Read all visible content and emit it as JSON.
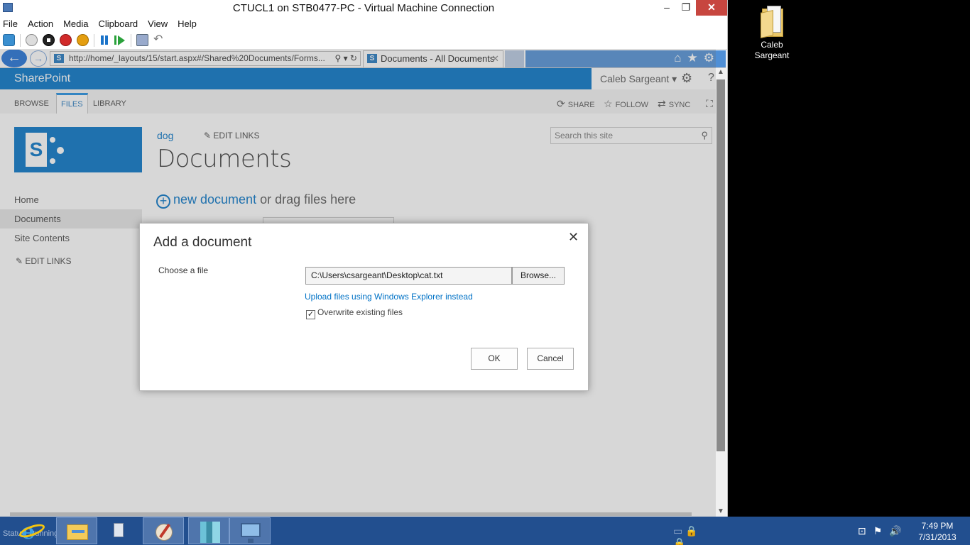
{
  "vm_window": {
    "title": "CTUCL1 on STB0477-PC - Virtual Machine Connection",
    "controls": {
      "minimize": "–",
      "maximize": "❐",
      "close": "✕"
    },
    "menu": [
      "File",
      "Action",
      "Media",
      "Clipboard",
      "View",
      "Help"
    ]
  },
  "browser": {
    "back_glyph": "←",
    "forward_glyph": "→",
    "address": "http://home/_layouts/15/start.aspx#/Shared%20Documents/Forms...",
    "address_tools": "⚲ ▾ ↻",
    "tab_title": "Documents - All Documents",
    "tab_close": "✕",
    "favicon_letter": "S",
    "right_icons": "⌂★⚙"
  },
  "sharepoint": {
    "brand": "SharePoint",
    "user": "Caleb Sargeant ▾",
    "gear_icon": "⚙",
    "help_icon": "?",
    "ribbon_tabs": [
      "BROWSE",
      "FILES",
      "LIBRARY"
    ],
    "active_tab": "FILES",
    "actions": {
      "share": "SHARE",
      "follow": "FOLLOW",
      "sync": "SYNC"
    },
    "logo_letter": "S",
    "breadcrumb": "dog",
    "edit_links": "EDIT LINKS",
    "page_title": "Documents",
    "search_placeholder": "Search this site",
    "quick_launch": [
      "Home",
      "Documents",
      "Site Contents"
    ],
    "selected_nav": "Documents",
    "quick_launch_edit": "EDIT LINKS",
    "new_document": "new document",
    "drag_text": "or drag files here"
  },
  "dialog": {
    "title": "Add a document",
    "close_glyph": "✕",
    "choose_label": "Choose a file",
    "file_value": "C:\\Users\\csargeant\\Desktop\\cat.txt",
    "browse_label": "Browse...",
    "upload_link": "Upload files using Windows Explorer instead",
    "overwrite_label": "Overwrite existing files",
    "overwrite_checked": true,
    "ok_label": "OK",
    "cancel_label": "Cancel"
  },
  "desktop": {
    "icon_label": "Caleb Sargeant"
  },
  "taskbar": {
    "status_text": "Status: Running",
    "clock_time": "7:49 PM",
    "clock_date": "7/31/2013",
    "tray_icons": "⊡⚑🔊"
  },
  "colors": {
    "sharepoint_blue": "#0072c6",
    "taskbar": "#224f8f",
    "close_red": "#c7463f"
  }
}
